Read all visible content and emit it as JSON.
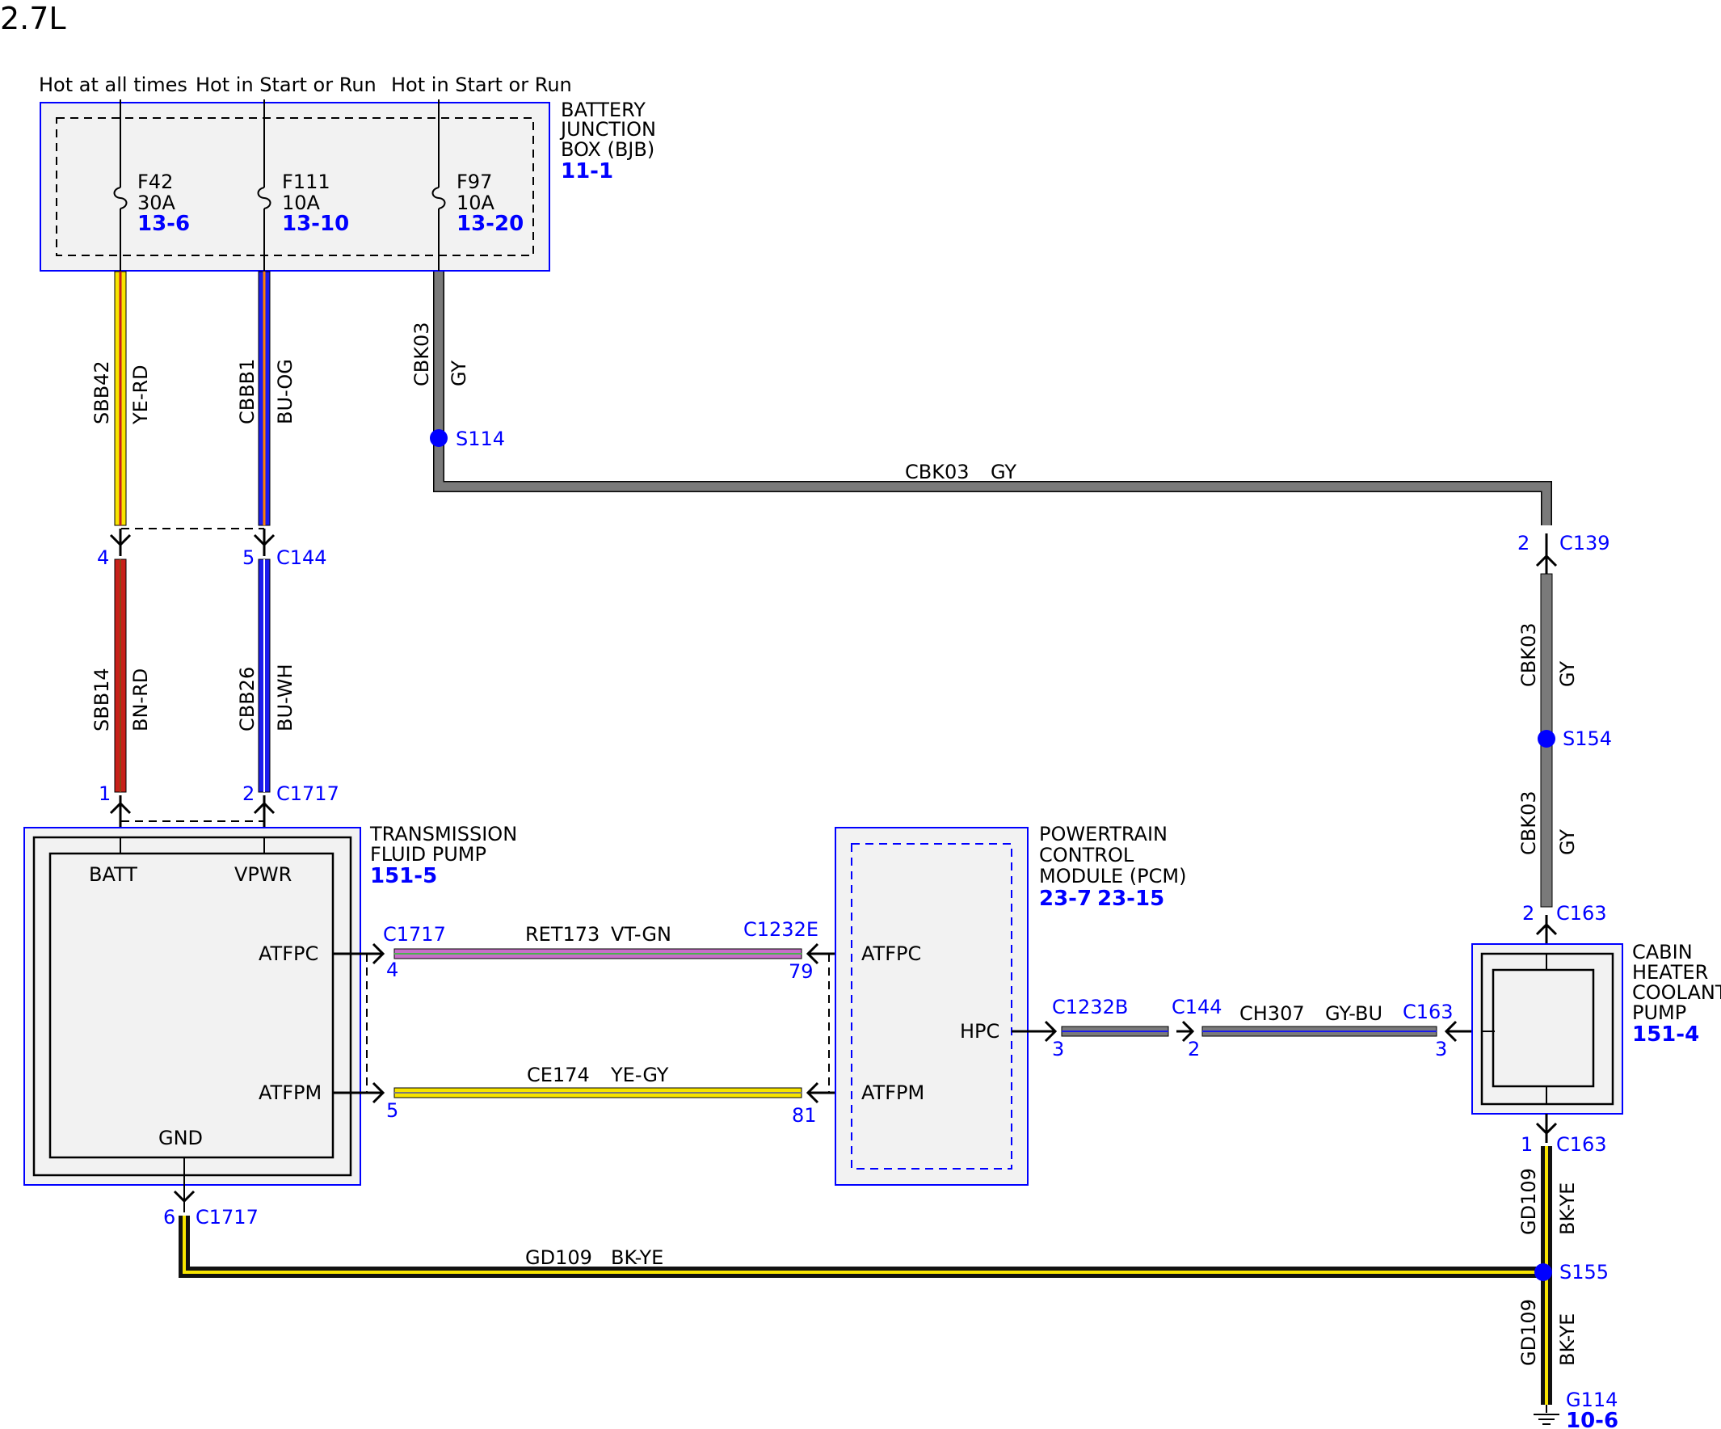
{
  "title": "2.7L",
  "power_sources": [
    "Hot at all times",
    "Hot in Start or Run",
    "Hot in Start or Run"
  ],
  "bjb": {
    "name": [
      "BATTERY",
      "JUNCTION",
      "BOX (BJB)"
    ],
    "ref": "11-1",
    "fuses": [
      {
        "id": "F42",
        "rating": "30A",
        "ref": "13-6"
      },
      {
        "id": "F111",
        "rating": "10A",
        "ref": "13-10"
      },
      {
        "id": "F97",
        "rating": "10A",
        "ref": "13-20"
      }
    ]
  },
  "tfp": {
    "name": [
      "TRANSMISSION",
      "FLUID PUMP"
    ],
    "ref": "151-5",
    "pins": {
      "batt": "BATT",
      "vpwr": "VPWR",
      "atfpc": "ATFPC",
      "atfpm": "ATFPM",
      "gnd": "GND"
    }
  },
  "pcm": {
    "name": [
      "POWERTRAIN",
      "CONTROL",
      "MODULE (PCM)"
    ],
    "refs": [
      "23-7",
      "23-15"
    ],
    "pins": {
      "atfpc": "ATFPC",
      "hpc": "HPC",
      "atfpm": "ATFPM"
    }
  },
  "chcp": {
    "name": [
      "CABIN",
      "HEATER",
      "COOLANT",
      "PUMP"
    ],
    "ref": "151-4"
  },
  "wires": {
    "sbb42": {
      "circuit": "SBB42",
      "color": "YE-RD"
    },
    "cbbb1": {
      "circuit": "CBBB1",
      "color": "BU-OG"
    },
    "cbk03": {
      "circuit": "CBK03",
      "color": "GY"
    },
    "sbb14": {
      "circuit": "SBB14",
      "color": "BN-RD"
    },
    "cbb26": {
      "circuit": "CBB26",
      "color": "BU-WH"
    },
    "ret173": {
      "circuit": "RET173",
      "color": "VT-GN"
    },
    "ce174": {
      "circuit": "CE174",
      "color": "YE-GY"
    },
    "ch307": {
      "circuit": "CH307",
      "color": "GY-BU"
    },
    "gd109": {
      "circuit": "GD109",
      "color": "BK-YE"
    }
  },
  "splices": {
    "s114": "S114",
    "s154": "S154",
    "s155": "S155"
  },
  "ground": {
    "id": "G114",
    "ref": "10-6"
  },
  "connectors": {
    "c144": "C144",
    "c1717": "C1717",
    "c139": "C139",
    "c163": "C163",
    "c1232e": "C1232E",
    "c1232b": "C1232B"
  },
  "pins": {
    "c144_sbb": "4",
    "c144_cbb": "5",
    "c1717_batt": "1",
    "c1717_vpwr": "2",
    "c1717_atfpc": "4",
    "c1717_atfpm": "5",
    "c1717_gnd": "6",
    "c1232e_atfpc": "79",
    "c1232e_atfpm": "81",
    "c1232b_hpc": "3",
    "c144_ch": "2",
    "c163_hpc": "3",
    "c139_gy": "2",
    "c163_gy": "2",
    "c163_gnd": "1"
  },
  "colors": {
    "outline_blue": "#0000ff",
    "module_fill": "#f2f2f2",
    "yellow": "#f7e400",
    "red": "#c8201a",
    "blue": "#1a1aee",
    "gray": "#7a7a7a",
    "black": "#111111",
    "violet": "#c86ec8",
    "green": "#4caf50",
    "orange": "#ff7f00",
    "white": "#ffffff"
  }
}
